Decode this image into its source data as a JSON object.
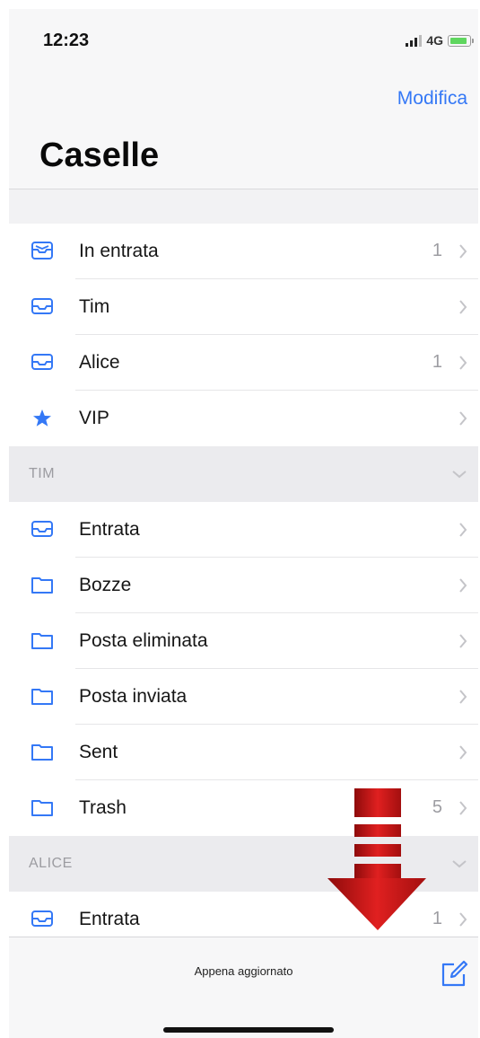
{
  "status": {
    "time": "12:23",
    "network": "4G"
  },
  "nav": {
    "edit_label": "Modifica",
    "title": "Caselle"
  },
  "favorites": [
    {
      "label": "In entrata",
      "count": "1",
      "icon": "inbox-stack-icon"
    },
    {
      "label": "Tim",
      "count": "",
      "icon": "inbox-tray-icon"
    },
    {
      "label": "Alice",
      "count": "1",
      "icon": "inbox-tray-icon"
    },
    {
      "label": "VIP",
      "count": "",
      "icon": "star-icon"
    }
  ],
  "sections": {
    "tim": {
      "title": "TIM",
      "items": [
        {
          "label": "Entrata",
          "count": "",
          "icon": "inbox-tray-icon"
        },
        {
          "label": "Bozze",
          "count": "",
          "icon": "folder-icon"
        },
        {
          "label": "Posta eliminata",
          "count": "",
          "icon": "folder-icon"
        },
        {
          "label": "Posta inviata",
          "count": "",
          "icon": "folder-icon"
        },
        {
          "label": "Sent",
          "count": "",
          "icon": "folder-icon"
        },
        {
          "label": "Trash",
          "count": "5",
          "icon": "folder-icon"
        }
      ]
    },
    "alice": {
      "title": "ALICE",
      "items": [
        {
          "label": "Entrata",
          "count": "1",
          "icon": "inbox-tray-icon"
        }
      ]
    }
  },
  "toolbar": {
    "status_text": "Appena aggiornato"
  },
  "colors": {
    "accent": "#3478f6",
    "arrow": "#c81414"
  }
}
